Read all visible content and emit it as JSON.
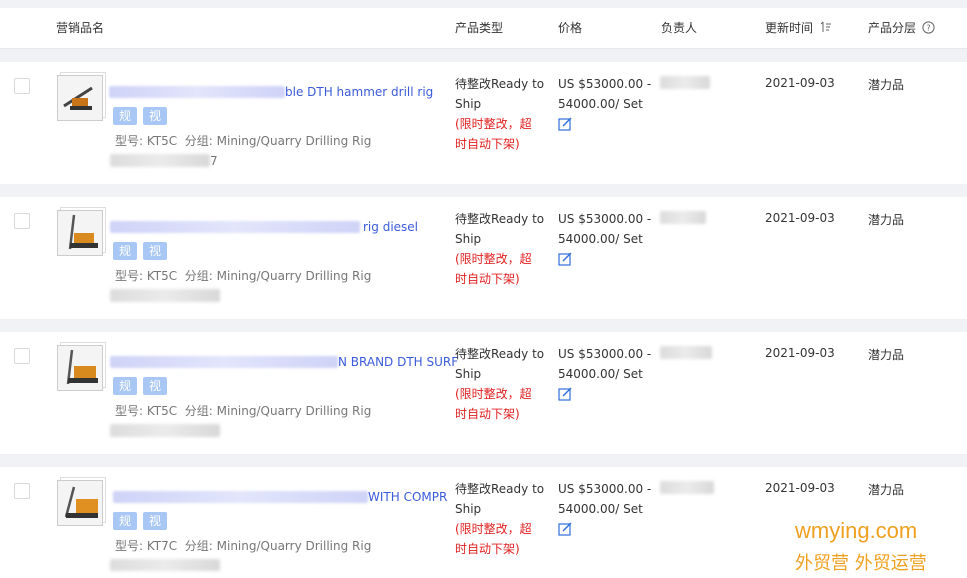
{
  "header": {
    "name": "营销品名",
    "type": "产品类型",
    "price": "价格",
    "owner": "负责人",
    "updated": "更新时间",
    "layer": "产品分层",
    "sort_icon": "sort-icon",
    "help_icon": "question-circle-icon"
  },
  "rows": [
    {
      "title_visible": "ble DTH hammer drill rig",
      "tag1": "规",
      "tag2": "视",
      "model": "型号: KT5C",
      "group": "分组: Mining/Quarry Drilling Rig",
      "tail": "7",
      "type_line1": "待整改Ready to",
      "type_line2": "Ship",
      "type_red1": "(限时整改，超",
      "type_red2": "时自动下架)",
      "price1": "US $53000.00 -",
      "price2": "54000.00/ Set",
      "date": "2021-09-03",
      "layer": "潜力品"
    },
    {
      "title_visible": "rig diesel",
      "tag1": "规",
      "tag2": "视",
      "model": "型号: KT5C",
      "group": "分组: Mining/Quarry Drilling Rig",
      "type_line1": "待整改Ready to",
      "type_line2": "Ship",
      "type_red1": "(限时整改，超",
      "type_red2": "时自动下架)",
      "price1": "US $53000.00 -",
      "price2": "54000.00/ Set",
      "date": "2021-09-03",
      "layer": "潜力品"
    },
    {
      "title_visible": "N BRAND DTH SURF",
      "tag1": "规",
      "tag2": "视",
      "model": "型号: KT5C",
      "group": "分组: Mining/Quarry Drilling Rig",
      "type_line1": "待整改Ready to",
      "type_line2": "Ship",
      "type_red1": "(限时整改，超",
      "type_red2": "时自动下架)",
      "price1": "US $53000.00 -",
      "price2": "54000.00/ Set",
      "date": "2021-09-03",
      "layer": "潜力品"
    },
    {
      "title_visible": "WITH COMPR",
      "tag1": "规",
      "tag2": "视",
      "model": "型号: KT7C",
      "group": "分组: Mining/Quarry Drilling Rig",
      "type_line1": "待整改Ready to",
      "type_line2": "Ship",
      "type_red1": "(限时整改，超",
      "type_red2": "时自动下架)",
      "price1": "US $53000.00 -",
      "price2": "54000.00/ Set",
      "date": "2021-09-03",
      "layer": "潜力品"
    }
  ],
  "watermark": {
    "line1": "wmying.com",
    "line2": "外贸营 外贸运营"
  },
  "colors": {
    "link": "#3b5bdb",
    "warning": "#e02020",
    "tag": "#a8c7f5",
    "watermark": "#f0a020"
  }
}
